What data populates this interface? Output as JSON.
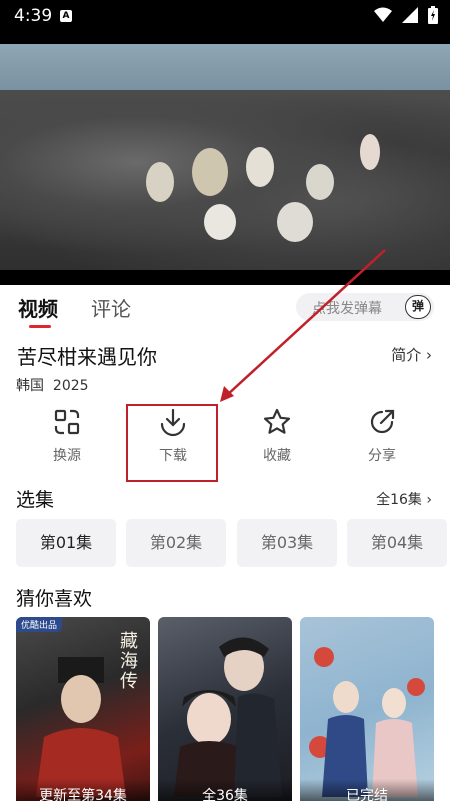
{
  "status_bar": {
    "time": "4:39",
    "notification_letter": "A"
  },
  "player": {
    "scene": "coastal-rocks-group-scene"
  },
  "tabs": {
    "video": "视频",
    "comments": "评论"
  },
  "danmu": {
    "placeholder": "点我发弹幕",
    "icon_label": "弹"
  },
  "show": {
    "title": "苦尽柑来遇见你",
    "intro_label": "简介",
    "country": "韩国",
    "year": "2025"
  },
  "actions": [
    {
      "label": "换源",
      "icon": "switch-source-icon"
    },
    {
      "label": "下载",
      "icon": "download-icon"
    },
    {
      "label": "收藏",
      "icon": "star-icon"
    },
    {
      "label": "分享",
      "icon": "share-icon"
    }
  ],
  "episodes_section": {
    "title": "选集",
    "total": "全16集",
    "items": [
      "第01集",
      "第02集",
      "第03集",
      "第04集"
    ]
  },
  "recommend_section": {
    "title": "猜你喜欢",
    "items": [
      {
        "caption": "更新至第34集",
        "badge": "优酷出品",
        "poster_text": "藏海传"
      },
      {
        "caption": "全36集",
        "badge": "",
        "poster_text": ""
      },
      {
        "caption": "已完结",
        "badge": "",
        "poster_text": ""
      }
    ]
  },
  "colors": {
    "accent": "#e0262f",
    "annotation": "#c0202a"
  }
}
